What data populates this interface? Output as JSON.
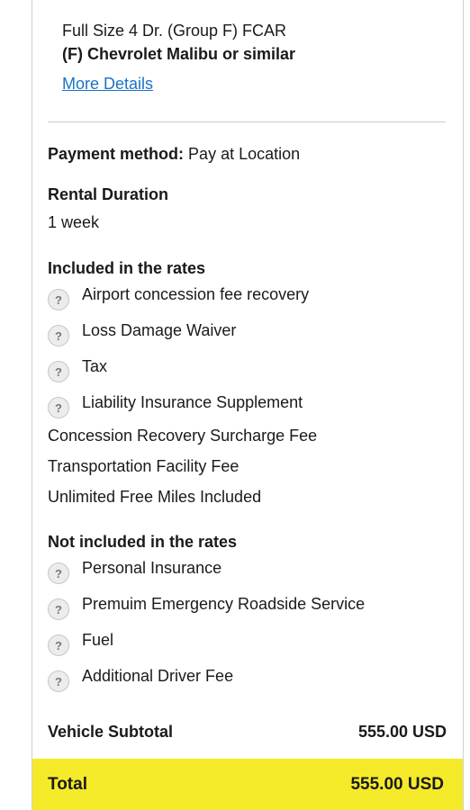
{
  "vehicle": {
    "class_line": "Full Size 4 Dr. (Group F) FCAR",
    "model_line": "(F) Chevrolet Malibu or similar",
    "more_details": "More Details"
  },
  "payment": {
    "label": "Payment method:",
    "value": "Pay at Location"
  },
  "rental_duration": {
    "title": "Rental Duration",
    "value": "1 week"
  },
  "included": {
    "title": "Included in the rates",
    "items_with_info": [
      {
        "label": "Airport concession fee recovery",
        "icon": "question-icon"
      },
      {
        "label": "Loss Damage Waiver",
        "icon": "question-icon"
      },
      {
        "label": "Tax",
        "icon": "question-icon"
      },
      {
        "label": "Liability Insurance Supplement",
        "icon": "question-icon"
      }
    ],
    "plain_items": [
      "Concession Recovery Surcharge Fee",
      "Transportation Facility Fee",
      "Unlimited Free Miles Included"
    ]
  },
  "not_included": {
    "title": "Not included in the rates",
    "items_with_info": [
      {
        "label": "Personal Insurance",
        "icon": "question-icon"
      },
      {
        "label": "Premuim Emergency Roadside Service",
        "icon": "question-icon"
      },
      {
        "label": "Fuel",
        "icon": "question-icon"
      },
      {
        "label": "Additional Driver Fee",
        "icon": "question-icon"
      }
    ]
  },
  "subtotal": {
    "label": "Vehicle Subtotal",
    "value": "555.00 USD"
  },
  "total": {
    "label": "Total",
    "value": "555.00 USD",
    "bar_color": "#f5ea2a"
  },
  "icon_glyph": "?",
  "link_color": "#1a73c6"
}
